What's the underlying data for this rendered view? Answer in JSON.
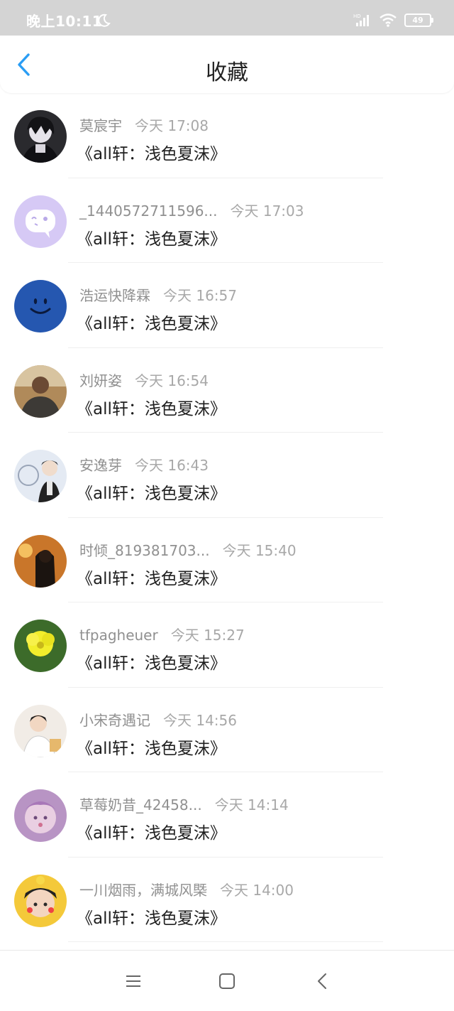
{
  "status_bar": {
    "time": "晚上10:11",
    "battery": "49",
    "icons": [
      "moon-icon",
      "hd-signal-icon",
      "wifi-icon",
      "battery-icon"
    ]
  },
  "header": {
    "title": "收藏",
    "back_icon": "chevron-left-icon",
    "accent_color": "#2a9df4"
  },
  "items": [
    {
      "name": "莫宸宇",
      "time": "今天 17:08",
      "title": "《all轩：浅色夏沫》"
    },
    {
      "name": "_1440572711596...",
      "time": "今天 17:03",
      "title": "《all轩：浅色夏沫》"
    },
    {
      "name": "浩运快降霖",
      "time": "今天 16:57",
      "title": "《all轩：浅色夏沫》"
    },
    {
      "name": "刘妍姿",
      "time": "今天 16:54",
      "title": "《all轩：浅色夏沫》"
    },
    {
      "name": "安逸芽",
      "time": "今天 16:43",
      "title": "《all轩：浅色夏沫》"
    },
    {
      "name": "时倾_819381703...",
      "time": "今天 15:40",
      "title": "《all轩：浅色夏沫》"
    },
    {
      "name": "tfpagheuer",
      "time": "今天 15:27",
      "title": "《all轩：浅色夏沫》"
    },
    {
      "name": "小宋奇遇记",
      "time": "今天 14:56",
      "title": "《all轩：浅色夏沫》"
    },
    {
      "name": "草莓奶昔_42458...",
      "time": "今天 14:14",
      "title": "《all轩：浅色夏沫》"
    },
    {
      "name": "一川烟雨，满城风槩",
      "time": "今天 14:00",
      "title": "《all轩：浅色夏沫》"
    }
  ],
  "nav_bar": {
    "icons": [
      "menu-icon",
      "home-square-icon",
      "back-chevron-icon"
    ]
  }
}
